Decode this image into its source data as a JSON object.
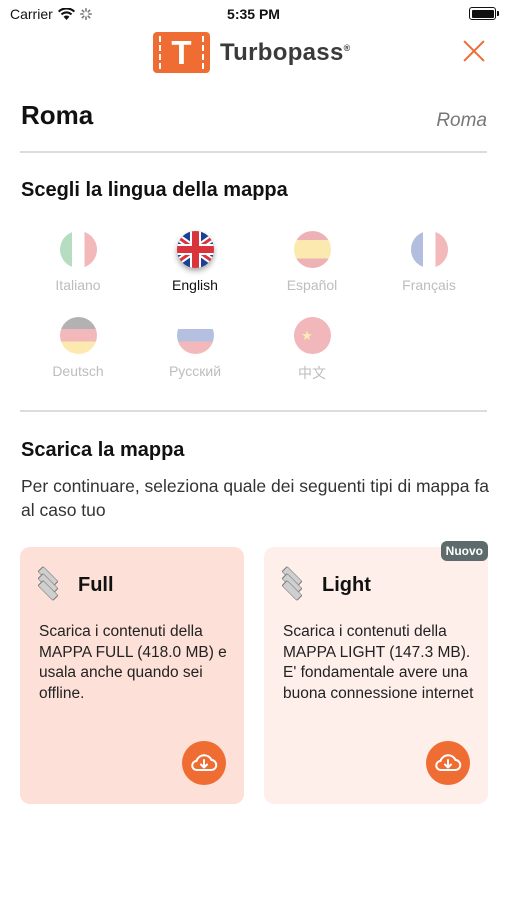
{
  "status": {
    "carrier": "Carrier",
    "time": "5:35 PM"
  },
  "header": {
    "brand": "Turbopass",
    "brand_mark": "T",
    "colors": {
      "brand": "#ef6c33"
    }
  },
  "city": {
    "title": "Roma",
    "subtitle": "Roma"
  },
  "language_section": {
    "title": "Scegli la lingua della mappa",
    "languages": [
      {
        "label": "Italiano",
        "flag": "italy-flag-icon",
        "selected": false
      },
      {
        "label": "English",
        "flag": "uk-flag-icon",
        "selected": true
      },
      {
        "label": "Español",
        "flag": "spain-flag-icon",
        "selected": false
      },
      {
        "label": "Français",
        "flag": "france-flag-icon",
        "selected": false
      },
      {
        "label": "Deutsch",
        "flag": "germany-flag-icon",
        "selected": false
      },
      {
        "label": "Рyсский",
        "flag": "russia-flag-icon",
        "selected": false
      },
      {
        "label": "中文",
        "flag": "china-flag-icon",
        "selected": false
      }
    ]
  },
  "download_section": {
    "title": "Scarica la mappa",
    "description": "Per continuare, seleziona quale dei seguenti tipi di mappa fa al caso tuo",
    "cards": [
      {
        "title": "Full",
        "text": "Scarica i contenuti della MAPPA FULL (418.0 MB) e usala anche quando sei offline.",
        "icon": "layers-icon",
        "action_icon": "cloud-download-icon"
      },
      {
        "title": "Light",
        "text": "Scarica i contenuti della MAPPA LIGHT (147.3 MB). E' fondamentale avere una buona connessione internet",
        "badge": "Nuovo",
        "icon": "layers-icon",
        "action_icon": "cloud-download-icon"
      }
    ]
  }
}
